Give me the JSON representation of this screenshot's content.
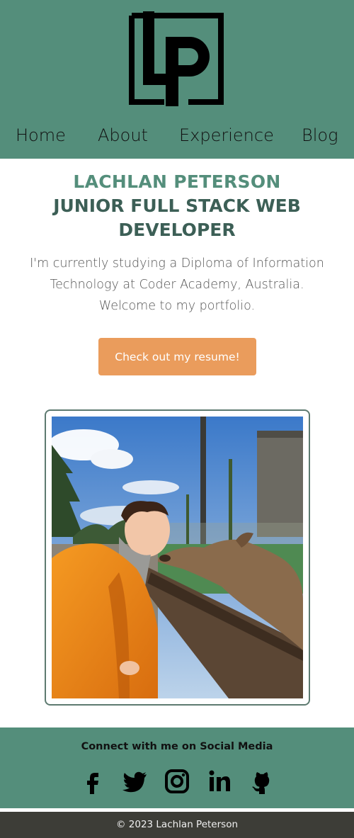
{
  "header": {
    "logo_icon": "lp-monogram-logo",
    "nav": [
      {
        "label": "Home"
      },
      {
        "label": "About"
      },
      {
        "label": "Experience"
      },
      {
        "label": "Blog"
      }
    ]
  },
  "hero": {
    "name": "LACHLAN PETERSON",
    "role": "JUNIOR FULL STACK WEB DEVELOPER",
    "intro": "I'm currently studying a Diploma of Information Technology at Coder Academy, Australia. Welcome to my portfolio.",
    "resume_button": "Check out my resume!"
  },
  "social": {
    "title": "Connect with me on Social Media",
    "icons": [
      "facebook-icon",
      "twitter-icon",
      "instagram-icon",
      "linkedin-icon",
      "github-icon"
    ]
  },
  "footer": {
    "copyright": "© 2023 Lachlan Peterson"
  },
  "colors": {
    "brand_green": "#548e7b",
    "heading_dark": "#3c5f56",
    "button_orange": "#ea9c5c",
    "footer_dark": "#3d3d37"
  }
}
